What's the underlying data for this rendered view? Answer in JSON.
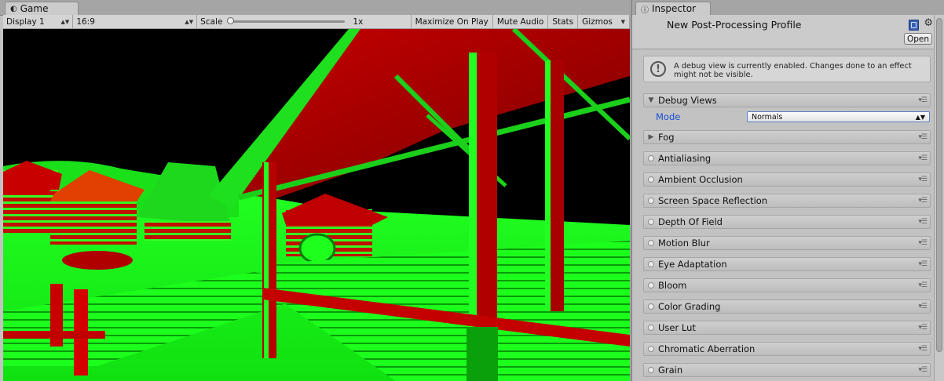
{
  "game": {
    "tab_label": "Game",
    "toolbar": {
      "display": "Display 1",
      "aspect": "16:9",
      "scale_label": "Scale",
      "scale_value": "1x",
      "scale_fraction": 0.0,
      "maximize_on_play": "Maximize On Play",
      "mute_audio": "Mute Audio",
      "stats": "Stats",
      "gizmos": "Gizmos"
    }
  },
  "inspector": {
    "tab_label": "Inspector",
    "title": "New Post-Processing Profile",
    "open_button": "Open",
    "helpbox": "A debug view is currently enabled. Changes done to an effect might not be visible.",
    "debug_views": {
      "label": "Debug Views",
      "mode_label": "Mode",
      "mode_value": "Normals"
    },
    "fog_label": "Fog",
    "effects": [
      "Antialiasing",
      "Ambient Occlusion",
      "Screen Space Reflection",
      "Depth Of Field",
      "Motion Blur",
      "Eye Adaptation",
      "Bloom",
      "Color Grading",
      "User Lut",
      "Chromatic Aberration",
      "Grain"
    ]
  },
  "colors": {
    "normals_green": "#11ff11",
    "normals_red": "#d40000",
    "mode_label_blue": "#1a4fd3"
  }
}
